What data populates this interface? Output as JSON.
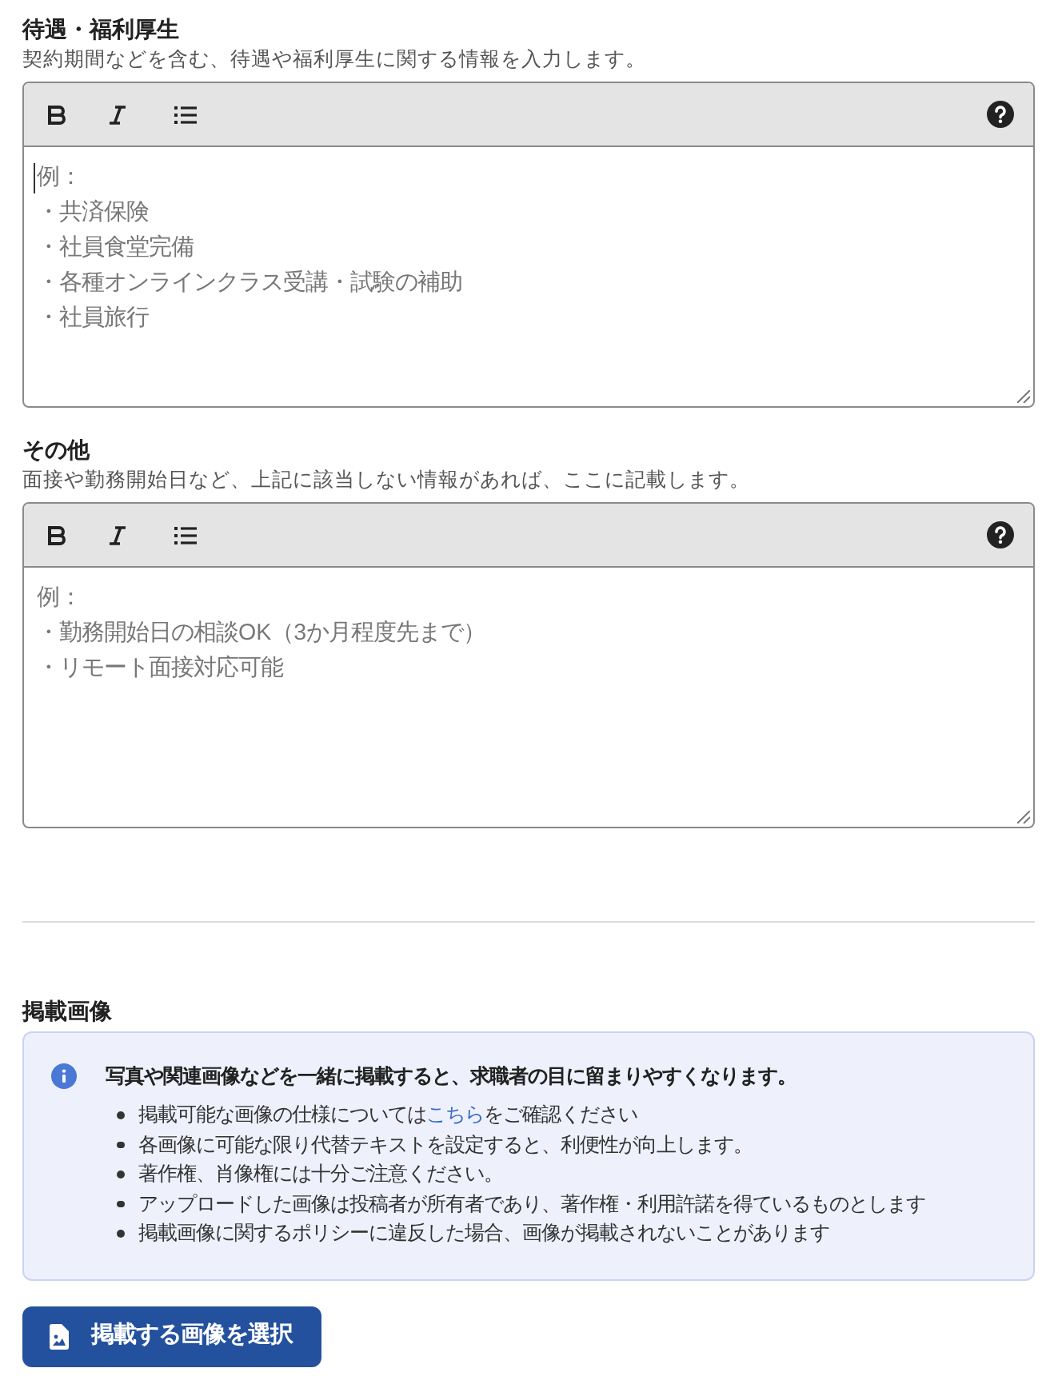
{
  "sections": [
    {
      "title": "待遇・福利厚生",
      "description": "契約期間などを含む、待遇や福利厚生に関する情報を入力します。",
      "editor": {
        "focused": true,
        "placeholder": [
          "例：",
          "・共済保険",
          "・社員食堂完備",
          "・各種オンラインクラス受講・試験の補助",
          "・社員旅行"
        ]
      }
    },
    {
      "title": "その他",
      "description": "面接や勤務開始日など、上記に該当しない情報があれば、ここに記載します。",
      "editor": {
        "focused": false,
        "placeholder": [
          "例：",
          "・勤務開始日の相談OK（3か月程度先まで）",
          "・リモート面接対応可能"
        ]
      }
    }
  ],
  "image_section": {
    "title": "掲載画像",
    "notice": {
      "heading": "写真や関連画像などを一緒に掲載すると、求職者の目に留まりやすくなります。",
      "items": [
        {
          "text": "掲載可能な画像の仕様については",
          "link": "こちら",
          "text_after": "をご確認ください"
        },
        {
          "text": "各画像に可能な限り代替テキストを設定すると、利便性が向上します。"
        },
        {
          "text": "著作権、肖像権には十分ご注意ください。"
        },
        {
          "text": "アップロードした画像は投稿者が所有者であり、著作権・利用許諾を得ているものとします"
        },
        {
          "text": "掲載画像に関するポリシーに違反した場合、画像が掲載されないことがあります"
        }
      ]
    },
    "button": "掲載する画像を選択"
  }
}
